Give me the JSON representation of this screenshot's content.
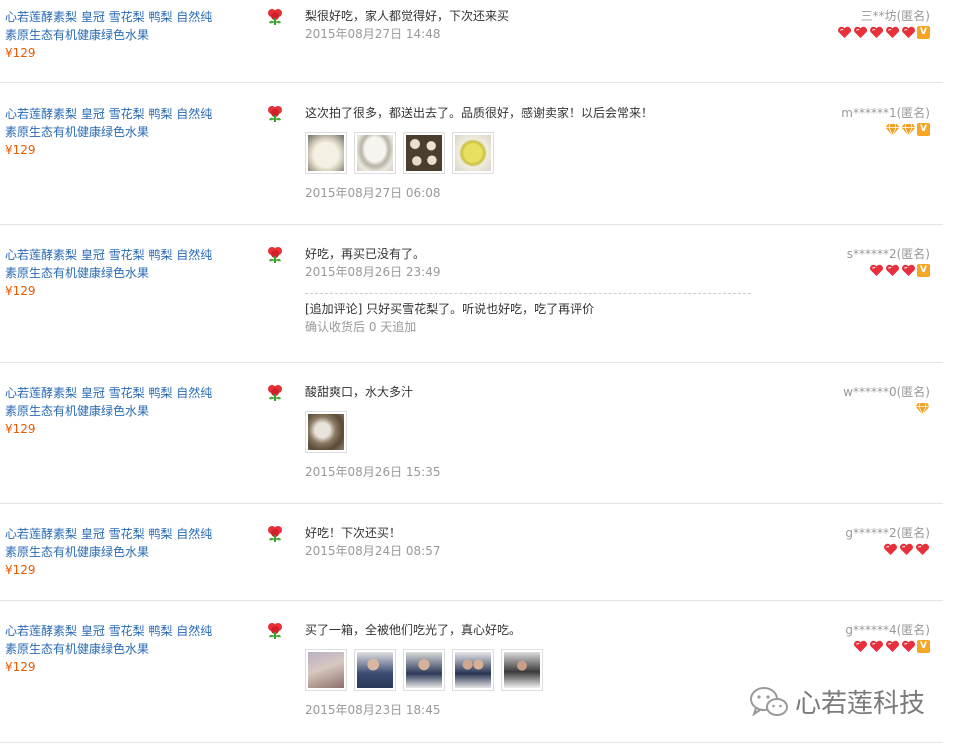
{
  "reviews": [
    {
      "product": {
        "name": "心若莲酵素梨 皇冠 雪花梨 鸭梨 自然纯素原生态有机健康绿色水果",
        "price": "¥129"
      },
      "comment": "梨很好吃，家人都觉得好，下次还来买",
      "date": "2015年08月27日 14:48",
      "user": "三**坊(匿名)",
      "badges": [
        "heart",
        "heart",
        "heart",
        "heart",
        "heart",
        "vip"
      ],
      "photos": []
    },
    {
      "product": {
        "name": "心若莲酵素梨 皇冠 雪花梨 鸭梨 自然纯素原生态有机健康绿色水果",
        "price": "¥129"
      },
      "comment": "这次拍了很多，都送出去了。品质很好，感谢卖家！以后会常来！",
      "date": "2015年08月27日 06:08",
      "user": "m******1(匿名)",
      "badges": [
        "diamond",
        "diamond",
        "vip"
      ],
      "photos": [
        "photo-pear-slices",
        "photo-pear-half",
        "photo-buns",
        "photo-pear-yellow"
      ]
    },
    {
      "product": {
        "name": "心若莲酵素梨 皇冠 雪花梨 鸭梨 自然纯素原生态有机健康绿色水果",
        "price": "¥129"
      },
      "comment": "好吃，再买已没有了。",
      "date": "2015年08月26日 23:49",
      "user": "s******2(匿名)",
      "badges": [
        "heart",
        "heart",
        "heart",
        "vip"
      ],
      "photos": [],
      "followup": {
        "text": "[追加评论] 只好买雪花梨了。听说也好吃，吃了再评价",
        "note": "确认收货后 0 天追加"
      }
    },
    {
      "product": {
        "name": "心若莲酵素梨 皇冠 雪花梨 鸭梨 自然纯素原生态有机健康绿色水果",
        "price": "¥129"
      },
      "comment": "酸甜爽口，水大多汁",
      "date": "2015年08月26日 15:35",
      "user": "w******0(匿名)",
      "badges": [
        "diamond"
      ],
      "photos": [
        "photo-pear-hand"
      ]
    },
    {
      "product": {
        "name": "心若莲酵素梨 皇冠 雪花梨 鸭梨 自然纯素原生态有机健康绿色水果",
        "price": "¥129"
      },
      "comment": "好吃！下次还买！",
      "date": "2015年08月24日 08:57",
      "user": "g******2(匿名)",
      "badges": [
        "heart",
        "heart",
        "heart"
      ],
      "photos": []
    },
    {
      "product": {
        "name": "心若莲酵素梨 皇冠 雪花梨 鸭梨 自然纯素原生态有机健康绿色水果",
        "price": "¥129"
      },
      "comment": "买了一箱，全被他们吃光了，真心好吃。",
      "date": "2015年08月23日 18:45",
      "user": "g******4(匿名)",
      "badges": [
        "heart",
        "heart",
        "heart",
        "heart",
        "vip"
      ],
      "photos": [
        "photo-people-1",
        "photo-people-2",
        "photo-people-3",
        "photo-people-4",
        "photo-people-5"
      ]
    }
  ],
  "watermark": "心若莲科技",
  "colors": {
    "link": "#2a6ab4",
    "price": "#e65a00",
    "heart": "#e8303a",
    "diamond": "#f0a020",
    "vip": "#f5a623"
  }
}
